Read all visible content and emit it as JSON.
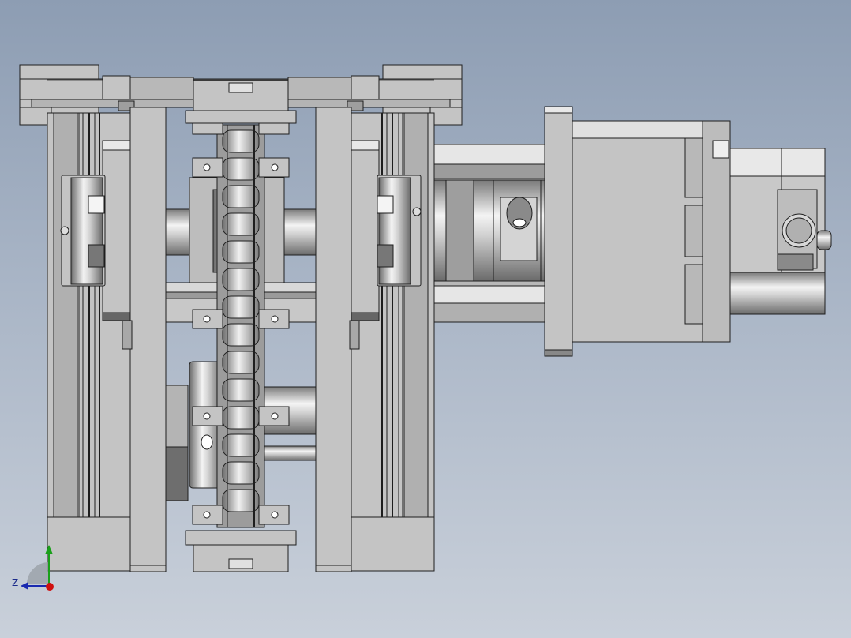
{
  "view": {
    "background_top": "#8d9db3",
    "background_bottom": "#c9d0da"
  },
  "model": {
    "part_fill": "#c4c4c4",
    "part_dark": "#8a8a8a",
    "edge_color": "#1e1e1e",
    "highlight": "#f2f2f2"
  },
  "triad": {
    "z_label": "Z",
    "y_color": "#1aa01a",
    "z_color": "#1a2ab0",
    "x_color": "#d01010"
  }
}
